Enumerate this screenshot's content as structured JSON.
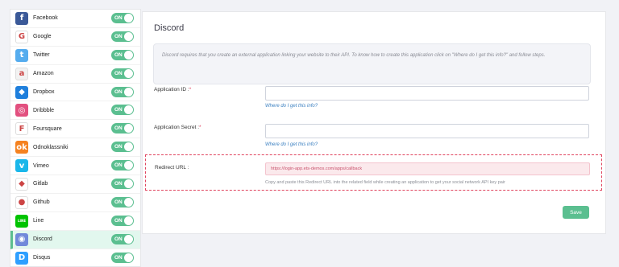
{
  "sidebar": {
    "items": [
      {
        "label": "Facebook",
        "icon": "facebook-icon",
        "glyph": "f",
        "color": "#3b5998",
        "toggle": "ON",
        "active": false
      },
      {
        "label": "Google",
        "icon": "google-icon",
        "glyph": "G",
        "color": "#ffffff",
        "toggle": "ON",
        "active": false
      },
      {
        "label": "Twitter",
        "icon": "twitter-icon",
        "glyph": "t",
        "color": "#55acee",
        "toggle": "ON",
        "active": false
      },
      {
        "label": "Amazon",
        "icon": "amazon-icon",
        "glyph": "a",
        "color": "#f2f2f2",
        "toggle": "ON",
        "active": false
      },
      {
        "label": "Dropbox",
        "icon": "dropbox-icon",
        "glyph": "◆",
        "color": "#1f7fdc",
        "toggle": "ON",
        "active": false
      },
      {
        "label": "Dribbble",
        "icon": "dribbble-icon",
        "glyph": "◎",
        "color": "#e2507f",
        "toggle": "ON",
        "active": false
      },
      {
        "label": "Foursquare",
        "icon": "foursquare-icon",
        "glyph": "F",
        "color": "#ffffff",
        "toggle": "ON",
        "active": false
      },
      {
        "label": "Odnoklassniki",
        "icon": "odnoklassniki-icon",
        "glyph": "ok",
        "color": "#f58220",
        "toggle": "ON",
        "active": false
      },
      {
        "label": "Vimeo",
        "icon": "vimeo-icon",
        "glyph": "v",
        "color": "#1ab7ea",
        "toggle": "ON",
        "active": false
      },
      {
        "label": "Gitlab",
        "icon": "gitlab-icon",
        "glyph": "◆",
        "color": "#ffffff",
        "toggle": "ON",
        "active": false
      },
      {
        "label": "Github",
        "icon": "github-icon",
        "glyph": "●",
        "color": "#ffffff",
        "toggle": "ON",
        "active": false
      },
      {
        "label": "Line",
        "icon": "line-icon",
        "glyph": "LINE",
        "color": "#00c300",
        "toggle": "ON",
        "active": false
      },
      {
        "label": "Discord",
        "icon": "discord-icon",
        "glyph": "◉",
        "color": "#7289da",
        "toggle": "ON",
        "active": true
      },
      {
        "label": "Disqus",
        "icon": "disqus-icon",
        "glyph": "D",
        "color": "#2e9fff",
        "toggle": "ON",
        "active": false
      }
    ]
  },
  "panel": {
    "title": "Discord",
    "notice": "Discord requires that you create an external application linking your website to their API. To know how to create this application click on \"Where do I get this info?\" and follow steps.",
    "app_id": {
      "label": "Application ID",
      "required": "*",
      "value": "",
      "help": "Where do I get this info?"
    },
    "app_secret": {
      "label": "Application Secret",
      "required": "*",
      "value": "",
      "help": "Where do I get this info?"
    },
    "redirect": {
      "label": "Redirect URL :",
      "value": "https://login-app.ets-demos.com/apps/callback",
      "help": "Copy and paste this Redirect URL into the related field while creating an application to get your social network API key pair"
    },
    "save_label": "Save"
  },
  "colors": {
    "accent": "#5bbf90",
    "danger": "#e0435e",
    "link": "#3a7fc0"
  }
}
